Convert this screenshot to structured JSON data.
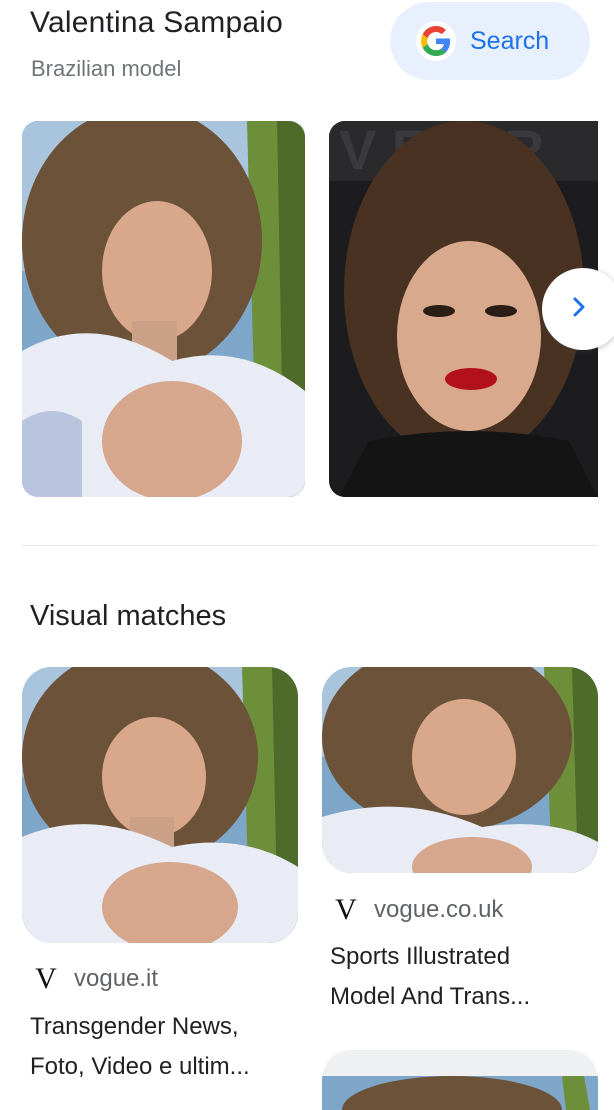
{
  "entity": {
    "name": "Valentina Sampaio",
    "description": "Brazilian model"
  },
  "search_button": {
    "label": "Search",
    "icon": "google-g-icon"
  },
  "carousel": {
    "next_icon": "chevron-right-icon"
  },
  "visual_matches": {
    "heading": "Visual matches",
    "items": [
      {
        "source_logo": "V",
        "source": "vogue.it",
        "title_line1": "Transgender News,",
        "title_line2": "Foto, Video e ultim..."
      },
      {
        "source_logo": "V",
        "source": "vogue.co.uk",
        "title_line1": "Sports Illustrated",
        "title_line2": "Model And Trans..."
      }
    ]
  },
  "colors": {
    "accent": "#1a73e8",
    "search_bg": "#e8f0fe",
    "text_primary": "#202124",
    "text_secondary": "#70757a"
  }
}
